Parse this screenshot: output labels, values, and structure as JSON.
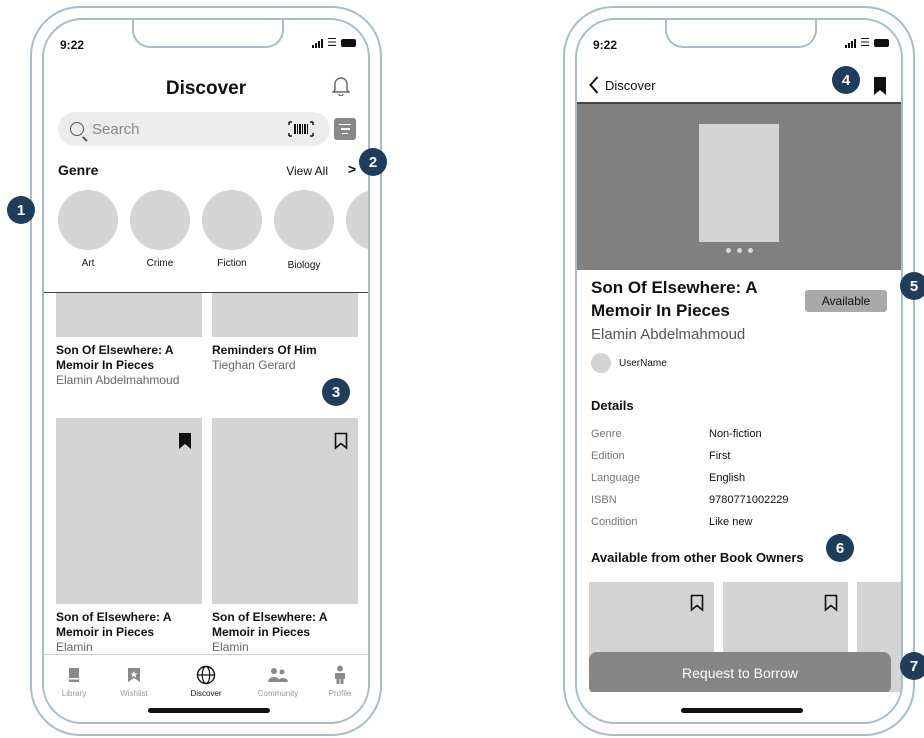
{
  "status_bar": {
    "time": "9:22"
  },
  "discover": {
    "title": "Discover",
    "search": {
      "placeholder": "Search"
    },
    "genre": {
      "title": "Genre",
      "view_all": "View All",
      "view_all_chevron": ">",
      "items": [
        "Art",
        "Crime",
        "Fiction",
        "Biology"
      ]
    },
    "books": [
      {
        "title": "Son Of Elsewhere: A Memoir In Pieces",
        "author": "Elamin Abdelmahmoud"
      },
      {
        "title": "Reminders Of Him",
        "author": "Tieghan Gerard"
      },
      {
        "title": "Son of Elsewhere: A Memoir in Pieces",
        "author": "Elamin",
        "bookmarked": true
      },
      {
        "title": "Son of Elsewhere: A Memoir in Pieces",
        "author": "Elamin",
        "bookmarked": false
      }
    ],
    "tabs": [
      "Library",
      "Wishlist",
      "Discover",
      "Community",
      "Profile"
    ],
    "active_tab": "Discover"
  },
  "detail": {
    "back_label": "Discover",
    "book_title": "Son Of Elsewhere: A Memoir In Pieces",
    "availability": "Available",
    "author": "Elamin Abdelmahmoud",
    "owner": "UserName",
    "details_title": "Details",
    "details": [
      {
        "label": "Genre",
        "value": "Non-fiction"
      },
      {
        "label": "Edition",
        "value": "First"
      },
      {
        "label": "Language",
        "value": "English"
      },
      {
        "label": "ISBN",
        "value": "9780771002229"
      },
      {
        "label": "Condition",
        "value": "Like new"
      }
    ],
    "others_title": "Available from other Book Owners",
    "request_button": "Request to Borrow"
  },
  "annotations": [
    "1",
    "2",
    "3",
    "4",
    "5",
    "6",
    "7"
  ],
  "colors": {
    "badge": "#1f3d59",
    "frame": "#a9bccb",
    "placeholder": "#d4d4d4",
    "hero": "#808080",
    "button": "#858585"
  }
}
